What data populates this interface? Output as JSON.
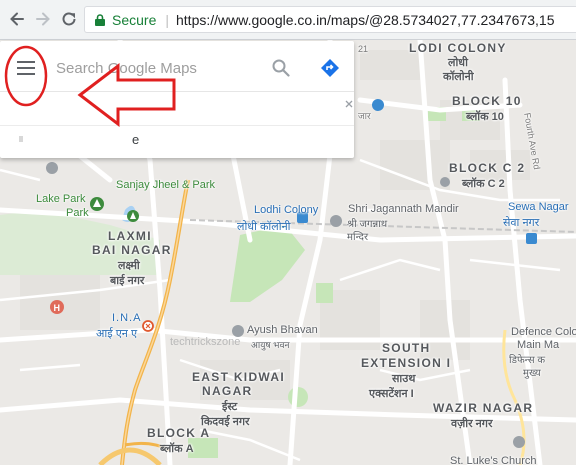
{
  "browser": {
    "secure_label": "Secure",
    "url": "https://www.google.co.in/maps/@28.5734027,77.2347673,15"
  },
  "search": {
    "placeholder": "Search Google Maps",
    "suggestion_fragment": "e"
  },
  "map": {
    "labels": {
      "lodi_colony": "LODI COLONY",
      "lodi_colony_hi": "लोधी",
      "lodi_colony_hi2": "कॉलोनी",
      "block10": "BLOCK 10",
      "block10_hi": "ब्लॉक 10",
      "blockc2": "BLOCK C 2",
      "blockc2_hi": "ब्लॉक C 2",
      "sanjay_jheel": "Sanjay Jheel & Park",
      "lake_park": "Lake Park",
      "park": "Park",
      "lodhi_colony_station": "Lodhi Colony",
      "lodhi_colony_station_hi": "लोधी कॉलोनी",
      "jagannath": "Shri Jagannath Mandir",
      "jagannath_hi": "श्री जगन्नाथ",
      "jagannath_hi2": "मन्दिर",
      "sewa_nagar": "Sewa Nagar",
      "sewa_nagar_hi": "सेवा नगर",
      "laxmi": "LAXMI",
      "bai_nagar": "BAI NAGAR",
      "laxmi_hi": "लक्ष्मी",
      "bai_nagar_hi": "बाई नगर",
      "ina": "I.N.A",
      "ina_hi": "आई एन ए",
      "ayush": "Ayush Bhavan",
      "ayush_hi": "आयुष भवन",
      "watermark": "techtrickszone",
      "east_kidwai": "EAST KIDWAI",
      "nagar": "NAGAR",
      "east_kidwai_hi": "ईस्ट",
      "east_kidwai_hi2": "किदवई नगर",
      "south_ext": "SOUTH",
      "extension": "EXTENSION I",
      "south_ext_hi": "साउथ",
      "south_ext_hi2": "एक्सटेंशन I",
      "defence": "Defence Colo",
      "defence2": "Main Ma",
      "defence_hi": "डिफेन्स क",
      "defence_hi2": "मुख्य",
      "wazir": "WAZIR NAGAR",
      "wazir_hi": "वज़ीर नगर",
      "block_a": "BLOCK A",
      "block_a_hi": "ब्लॉक A",
      "st_luke": "St. Luke's Church",
      "num21": "21",
      "road_jor": "जार",
      "road_fourth": "Fourth Ave Rd"
    }
  },
  "colors": {
    "annotation": "#e02020",
    "directions": "#1a73e8",
    "secure": "#188038"
  }
}
